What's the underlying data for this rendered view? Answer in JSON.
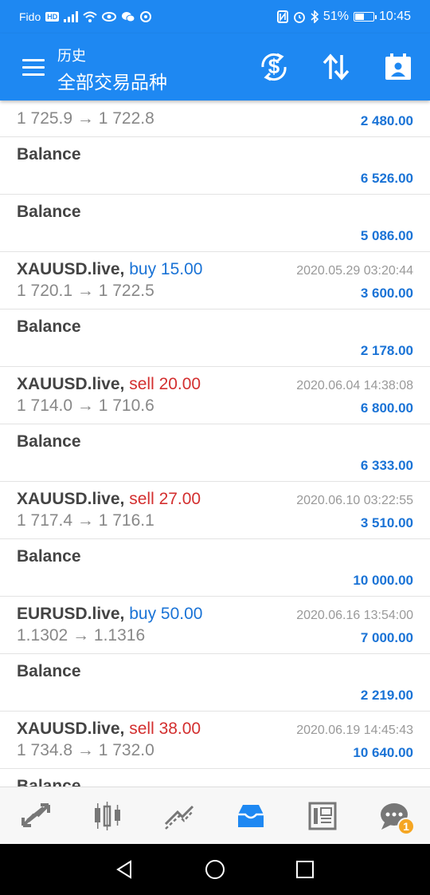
{
  "status_bar": {
    "carrier": "Fido",
    "hd": "HD",
    "battery_percent": "51%",
    "battery_level": 0.51,
    "time": "10:45"
  },
  "header": {
    "subtitle": "历史",
    "title": "全部交易品种"
  },
  "rows": [
    {
      "kind": "trade",
      "symbol": "",
      "sep": "",
      "type": "",
      "type_class": "",
      "time": "",
      "prices": "1 725.9 → 1 722.8",
      "profit": "2 480.00"
    },
    {
      "kind": "balance",
      "label": "Balance",
      "profit": "6 526.00"
    },
    {
      "kind": "balance",
      "label": "Balance",
      "profit": "5 086.00"
    },
    {
      "kind": "trade",
      "symbol": "XAUUSD.live",
      "sep": ", ",
      "type": "buy 15.00",
      "type_class": "buy",
      "time": "2020.05.29 03:20:44",
      "prices": "1 720.1 → 1 722.5",
      "profit": "3 600.00"
    },
    {
      "kind": "balance",
      "label": "Balance",
      "profit": "2 178.00"
    },
    {
      "kind": "trade",
      "symbol": "XAUUSD.live",
      "sep": ", ",
      "type": "sell 20.00",
      "type_class": "sell",
      "time": "2020.06.04 14:38:08",
      "prices": "1 714.0 → 1 710.6",
      "profit": "6 800.00"
    },
    {
      "kind": "balance",
      "label": "Balance",
      "profit": "6 333.00"
    },
    {
      "kind": "trade",
      "symbol": "XAUUSD.live",
      "sep": ", ",
      "type": "sell 27.00",
      "type_class": "sell",
      "time": "2020.06.10 03:22:55",
      "prices": "1 717.4 → 1 716.1",
      "profit": "3 510.00"
    },
    {
      "kind": "balance",
      "label": "Balance",
      "profit": "10 000.00"
    },
    {
      "kind": "trade",
      "symbol": "EURUSD.live",
      "sep": ", ",
      "type": "buy 50.00",
      "type_class": "buy",
      "time": "2020.06.16 13:54:00",
      "prices": "1.1302 → 1.1316",
      "profit": "7 000.00"
    },
    {
      "kind": "balance",
      "label": "Balance",
      "profit": "2 219.00"
    },
    {
      "kind": "trade",
      "symbol": "XAUUSD.live",
      "sep": ", ",
      "type": "sell 38.00",
      "type_class": "sell",
      "time": "2020.06.19 14:45:43",
      "prices": "1 734.8 → 1 732.0",
      "profit": "10 640.00"
    },
    {
      "kind": "balance",
      "label": "Balance",
      "profit": ""
    }
  ],
  "tabs": [
    {
      "name": "tab-quotes",
      "icon": "quotes-arrows-icon",
      "active": false
    },
    {
      "name": "tab-chart",
      "icon": "candlestick-icon",
      "active": false
    },
    {
      "name": "tab-trade",
      "icon": "trade-line-icon",
      "active": false
    },
    {
      "name": "tab-history",
      "icon": "inbox-icon",
      "active": true
    },
    {
      "name": "tab-news",
      "icon": "news-icon",
      "active": false
    },
    {
      "name": "tab-messages",
      "icon": "chat-icon",
      "active": false,
      "badge": "1"
    }
  ],
  "colors": {
    "accent": "#1e88f2",
    "buy": "#1a73d6",
    "sell": "#d32f2f",
    "profit": "#1a73d6",
    "badge": "#f5a623"
  }
}
